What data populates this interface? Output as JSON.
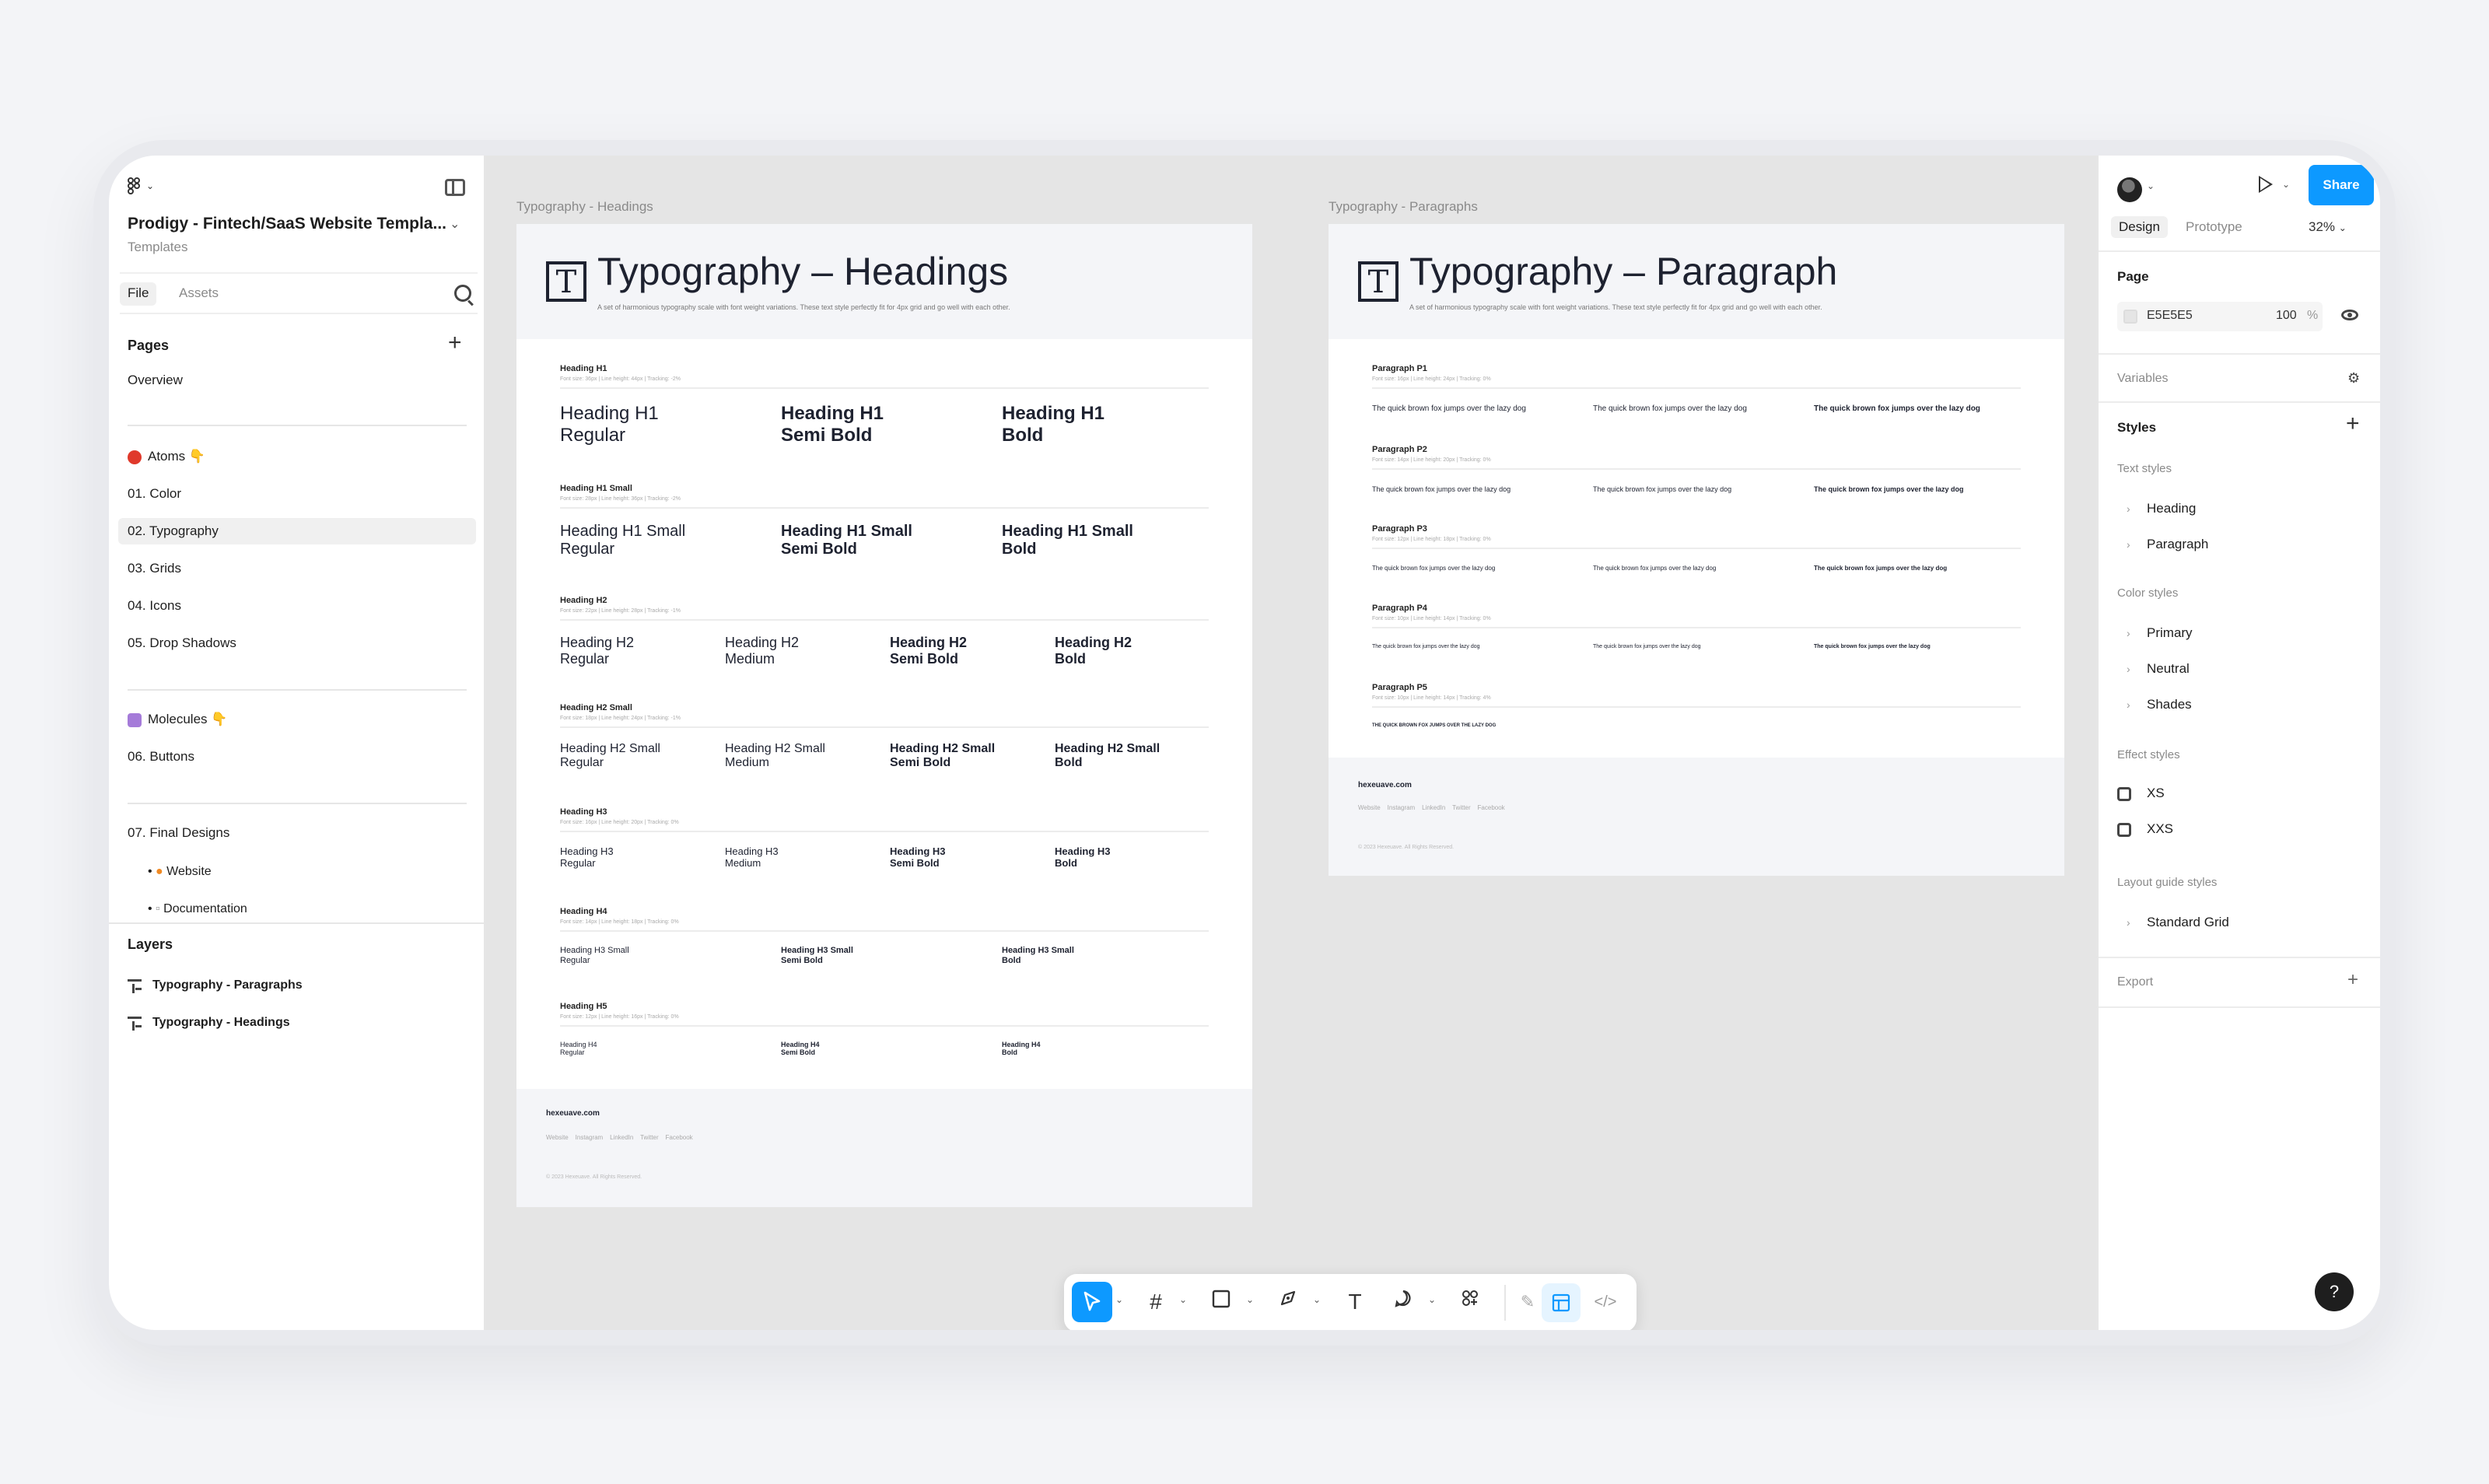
{
  "left_panel": {
    "file_title": "Prodigy - Fintech/SaaS Website Templa...",
    "file_subtitle": "Templates",
    "tabs": [
      "File",
      "Assets"
    ],
    "pages_heading": "Pages",
    "pages": [
      "Overview",
      "Atoms 👇",
      "01. Color",
      "02. Typography",
      "03. Grids",
      "04. Icons",
      "05.  Drop Shadows",
      "Molecules 👇",
      "06. Buttons",
      "07. Final Designs",
      "Website",
      "Documentation"
    ],
    "selected_page": "02. Typography",
    "layers_heading": "Layers",
    "layers": [
      "Typography - Paragraphs",
      "Typography - Headings"
    ]
  },
  "canvas": {
    "background": "#E5E5E5",
    "headings_frame": {
      "label": "Typography - Headings",
      "title": "Typography – Headings",
      "description": "A set of harmonious typography scale with font weight variations. These text style perfectly fit for 4px grid and go well with each other.",
      "sections": [
        {
          "label": "Heading H1",
          "meta": "Font size: 36px | Line height: 44px | Tracking: -2%",
          "items": [
            {
              "l1": "Heading H1",
              "l2": "Regular"
            },
            {
              "l1": "Heading H1",
              "l2": "Semi Bold"
            },
            {
              "l1": "Heading H1",
              "l2": "Bold"
            }
          ]
        },
        {
          "label": "Heading H1 Small",
          "meta": "Font size: 28px | Line height: 36px | Tracking: -2%",
          "items": [
            {
              "l1": "Heading H1 Small",
              "l2": "Regular"
            },
            {
              "l1": "Heading H1  Small",
              "l2": "Semi Bold"
            },
            {
              "l1": "Heading H1 Small",
              "l2": "Bold"
            }
          ]
        },
        {
          "label": "Heading H2",
          "meta": "Font size: 22px | Line height: 28px | Tracking: -1%",
          "items": [
            {
              "l1": "Heading H2",
              "l2": "Regular"
            },
            {
              "l1": "Heading H2",
              "l2": "Medium"
            },
            {
              "l1": "Heading H2",
              "l2": "Semi Bold"
            },
            {
              "l1": "Heading H2",
              "l2": "Bold"
            }
          ]
        },
        {
          "label": "Heading H2 Small",
          "meta": "Font size: 18px | Line height: 24px | Tracking: -1%",
          "items": [
            {
              "l1": "Heading H2 Small",
              "l2": "Regular"
            },
            {
              "l1": "Heading H2 Small",
              "l2": "Medium"
            },
            {
              "l1": "Heading H2 Small",
              "l2": "Semi Bold"
            },
            {
              "l1": "Heading H2 Small",
              "l2": "Bold"
            }
          ]
        },
        {
          "label": "Heading H3",
          "meta": "Font size: 16px | Line height: 20px | Tracking: 0%",
          "items": [
            {
              "l1": "Heading H3",
              "l2": "Regular"
            },
            {
              "l1": "Heading H3",
              "l2": "Medium"
            },
            {
              "l1": "Heading H3",
              "l2": "Semi Bold"
            },
            {
              "l1": "Heading H3",
              "l2": "Bold"
            }
          ]
        },
        {
          "label": "Heading H4",
          "meta": "Font size: 14px | Line height: 18px | Tracking: 0%",
          "items": [
            {
              "l1": "Heading H3 Small",
              "l2": "Regular"
            },
            {
              "l1": "Heading H3 Small",
              "l2": "Semi Bold"
            },
            {
              "l1": "Heading H3 Small",
              "l2": "Bold"
            }
          ]
        },
        {
          "label": "Heading H5",
          "meta": "Font size: 12px | Line height: 16px | Tracking: 0%",
          "items": [
            {
              "l1": "Heading H4",
              "l2": "Regular"
            },
            {
              "l1": "Heading H4",
              "l2": "Semi Bold"
            },
            {
              "l1": "Heading H4",
              "l2": "Bold"
            }
          ]
        }
      ],
      "footer": {
        "brand": "hexeuave.com",
        "links": "Website    Instagram    LinkedIn    Twitter    Facebook",
        "copy": "© 2023 Hexeuave. All Rights Reserved."
      }
    },
    "paragraphs_frame": {
      "label": "Typography - Paragraphs",
      "title": "Typography – Paragraph",
      "description": "A set of harmonious typography scale with font weight variations. These text style perfectly fit for 4px grid and go well with each other.",
      "sections": [
        {
          "label": "Paragraph P1",
          "meta": "Font size: 16px | Line height: 24px | Tracking: 0%",
          "text": "The quick brown fox jumps over the lazy dog"
        },
        {
          "label": "Paragraph P2",
          "meta": "Font size: 14px | Line height: 20px | Tracking: 0%",
          "text": "The quick brown fox jumps over the lazy dog"
        },
        {
          "label": "Paragraph P3",
          "meta": "Font size: 12px | Line height: 18px | Tracking: 0%",
          "text": "The quick brown fox jumps over the lazy dog"
        },
        {
          "label": "Paragraph P4",
          "meta": "Font size: 10px | Line height: 14px | Tracking: 0%",
          "text": "The quick brown fox jumps over the lazy dog"
        },
        {
          "label": "Paragraph P5",
          "meta": "Font size: 10px | Line height: 14px | Tracking: 4%",
          "text": "THE QUICK BROWN FOX JUMPS OVER THE LAZY DOG"
        }
      ],
      "footer": {
        "brand": "hexeuave.com",
        "links": "Website    Instagram    LinkedIn    Twitter    Facebook",
        "copy": "© 2023 Hexeuave. All Rights Reserved."
      }
    }
  },
  "toolbar": {
    "tools": [
      "move-tool",
      "frame-tool",
      "rectangle-tool",
      "pen-tool",
      "text-tool",
      "comment-tool",
      "actions-tool",
      "draw-mode",
      "design-mode",
      "dev-mode"
    ],
    "selected": "move-tool",
    "accent": "#0D99FF"
  },
  "right_panel": {
    "share_label": "Share",
    "tabs": [
      "Design",
      "Prototype"
    ],
    "zoom": "32%",
    "page_heading": "Page",
    "page_fill_hex": "E5E5E5",
    "page_fill_opacity": "100",
    "percent_sign": "%",
    "variables": "Variables",
    "styles": "Styles",
    "text_styles_heading": "Text styles",
    "text_styles": [
      "Heading",
      "Paragraph"
    ],
    "color_styles_heading": "Color styles",
    "color_styles": [
      "Primary",
      "Neutral",
      "Shades"
    ],
    "effect_styles_heading": "Effect styles",
    "effect_styles": [
      "XS",
      "XXS"
    ],
    "layout_styles_heading": "Layout guide styles",
    "layout_styles": [
      "Standard Grid"
    ],
    "export": "Export",
    "help": "?"
  }
}
